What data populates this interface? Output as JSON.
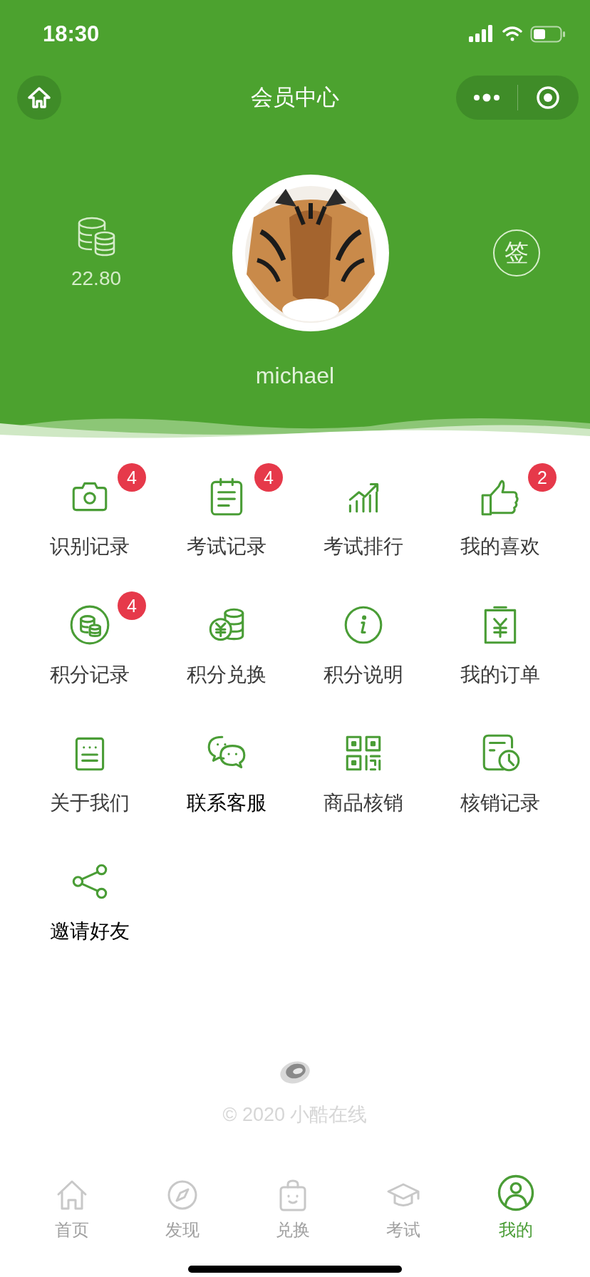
{
  "status_bar": {
    "time": "18:30"
  },
  "nav": {
    "title": "会员中心"
  },
  "profile": {
    "points": "22.80",
    "sign_label": "签",
    "username": "michael"
  },
  "menu": [
    {
      "label": "识别记录",
      "badge": "4"
    },
    {
      "label": "考试记录",
      "badge": "4"
    },
    {
      "label": "考试排行"
    },
    {
      "label": "我的喜欢",
      "badge": "2"
    },
    {
      "label": "积分记录",
      "badge": "4"
    },
    {
      "label": "积分兑换"
    },
    {
      "label": "积分说明"
    },
    {
      "label": "我的订单"
    },
    {
      "label": "关于我们"
    },
    {
      "label": "联系客服",
      "kind": "button"
    },
    {
      "label": "商品核销"
    },
    {
      "label": "核销记录"
    },
    {
      "label": "邀请好友",
      "kind": "button"
    }
  ],
  "footer": {
    "copyright": "© 2020 小酷在线"
  },
  "tab_bar": [
    {
      "label": "首页",
      "selected": false
    },
    {
      "label": "发现",
      "selected": false
    },
    {
      "label": "兑换",
      "selected": false
    },
    {
      "label": "考试",
      "selected": false
    },
    {
      "label": "我的",
      "selected": true
    }
  ]
}
